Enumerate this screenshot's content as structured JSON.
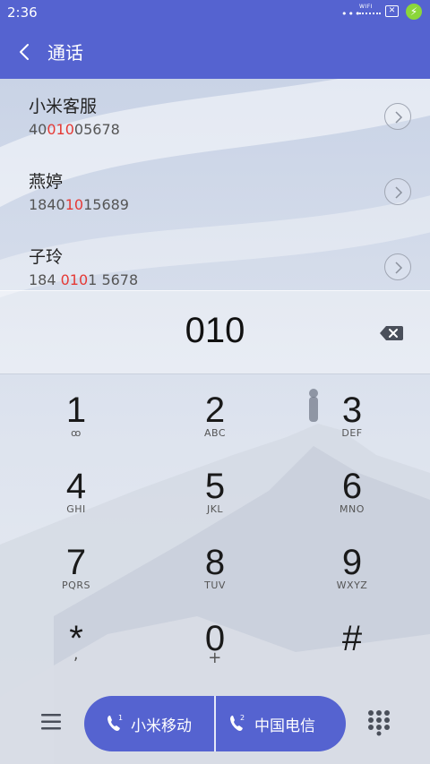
{
  "status_bar": {
    "time": "2:36",
    "signal_dots": "•••",
    "wifi_label": "WIFI",
    "sim_icon": "close-box-icon",
    "battery_icon": "charging-icon",
    "battery_symbol": "⚡"
  },
  "header": {
    "title": "通话",
    "back_icon": "chevron-left-icon"
  },
  "contacts": [
    {
      "name": "小米客服",
      "number_before": "40",
      "number_match": "010",
      "number_after": "05678"
    },
    {
      "name": "燕婷",
      "number_before": "1840",
      "number_match": "10",
      "number_after": "15689"
    },
    {
      "name": "子玲",
      "number_before": "184 ",
      "number_match": "010",
      "number_after": "1 5678"
    }
  ],
  "dialer": {
    "display": "010",
    "backspace_icon": "backspace-icon"
  },
  "keypad": [
    {
      "digit": "1",
      "letters": "ꝏ"
    },
    {
      "digit": "2",
      "letters": "ABC"
    },
    {
      "digit": "3",
      "letters": "DEF"
    },
    {
      "digit": "4",
      "letters": "GHI"
    },
    {
      "digit": "5",
      "letters": "JKL"
    },
    {
      "digit": "6",
      "letters": "MNO"
    },
    {
      "digit": "7",
      "letters": "PQRS"
    },
    {
      "digit": "8",
      "letters": "TUV"
    },
    {
      "digit": "9",
      "letters": "WXYZ"
    },
    {
      "digit": "*",
      "letters": ","
    },
    {
      "digit": "0",
      "letters": "+"
    },
    {
      "digit": "#",
      "letters": ""
    }
  ],
  "bottom_bar": {
    "menu_icon": "menu-icon",
    "sim1_label": "小米移动",
    "sim2_label": "中国电信",
    "keypad_icon": "dialpad-icon"
  },
  "colors": {
    "accent": "#5563d0",
    "match_highlight": "#e53935"
  }
}
